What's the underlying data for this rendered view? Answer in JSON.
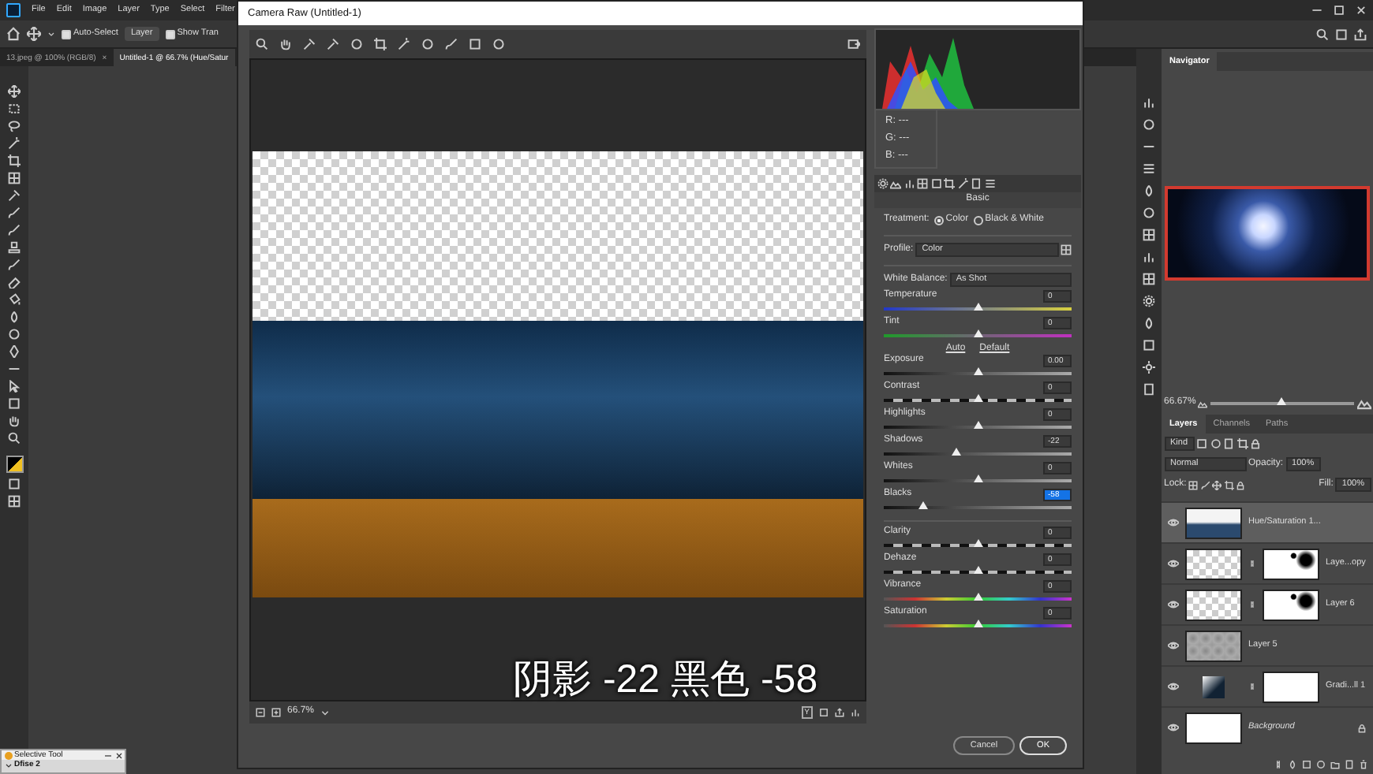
{
  "menu_bar": {
    "items": [
      "File",
      "Edit",
      "Image",
      "Layer",
      "Type",
      "Select",
      "Filter"
    ]
  },
  "options_bar": {
    "auto_select": {
      "label": "Auto-Select",
      "checked": true
    },
    "target": "Layer",
    "show_transform": {
      "label": "Show Tran",
      "checked": true
    }
  },
  "document_tabs": [
    {
      "label": "13.jpeg @ 100% (RGB/8)",
      "selected": false,
      "close": "×"
    },
    {
      "label": "Untitled-1 @ 66.7% (Hue/Satur",
      "selected": true
    }
  ],
  "navigator": {
    "title": "Navigator",
    "zoom": "66.67%",
    "level": 0.5
  },
  "layers_panel": {
    "tabs": [
      {
        "label": "Layers",
        "selected": true
      },
      {
        "label": "Channels",
        "selected": false
      },
      {
        "label": "Paths",
        "selected": false
      }
    ],
    "filter": "Kind",
    "blend_mode": "Normal",
    "opacity_label": "Opacity:",
    "opacity": "100%",
    "lock_label": "Lock:",
    "fill_label": "Fill:",
    "fill": "100%",
    "layers": [
      {
        "name": "Hue/Saturation 1...",
        "selected": true,
        "visible": true,
        "thumbnail": {
          "kind": "adjusted"
        },
        "locked": false
      },
      {
        "name": "Laye...opy",
        "selected": false,
        "visible": true,
        "thumbnail": {
          "kind": "photo"
        },
        "mask": {
          "kind": "spots"
        },
        "locked": false
      },
      {
        "name": "Layer 6",
        "selected": false,
        "visible": true,
        "thumbnail": {
          "kind": "photo"
        },
        "mask": {
          "kind": "spots"
        },
        "locked": false
      },
      {
        "name": "Layer 5",
        "selected": false,
        "visible": true,
        "thumbnail": {
          "kind": "checker"
        },
        "locked": false
      },
      {
        "name": "Gradi...ll 1",
        "selected": false,
        "visible": true,
        "thumbnail": {
          "kind": "gradient"
        },
        "mask": {
          "kind": "white"
        },
        "locked": false
      },
      {
        "name": "Background",
        "selected": false,
        "visible": true,
        "thumbnail": {
          "kind": "white"
        },
        "locked": true
      }
    ]
  },
  "selective_tool": {
    "title": "Selective Tool",
    "item": "Dfise 2"
  },
  "dialog": {
    "title": "Camera Raw (Untitled-1)",
    "zoom": "66.7%",
    "view_toggle": "Y",
    "caption": "阴影 -22 黑色 -58",
    "readout": [
      "R: ---",
      "G: ---",
      "B: ---"
    ],
    "panel_title": "Basic",
    "treatment": {
      "label": "Treatment:",
      "options": [
        {
          "label": "Color",
          "selected": true
        },
        {
          "label": "Black & White",
          "selected": false
        }
      ]
    },
    "profile": {
      "label": "Profile:",
      "value": "Color"
    },
    "white_balance": {
      "label": "White Balance:",
      "value": "As Shot"
    },
    "white_balance_sliders": [
      {
        "label": "Temperature",
        "value": "0",
        "level": 0.5,
        "kind": "temperature",
        "focused": false
      },
      {
        "label": "Tint",
        "value": "0",
        "level": 0.5,
        "kind": "tint",
        "focused": false
      }
    ],
    "tone_links": [
      "Auto",
      "Default"
    ],
    "tone_sliders": [
      {
        "label": "Exposure",
        "value": "0.00",
        "level": 0.5,
        "kind": "gradient",
        "focused": false
      },
      {
        "label": "Contrast",
        "value": "0",
        "level": 0.5,
        "kind": "dashed",
        "focused": false
      },
      {
        "label": "Highlights",
        "value": "0",
        "level": 0.5,
        "kind": "gradient",
        "focused": false
      },
      {
        "label": "Shadows",
        "value": "-22",
        "level": 0.39,
        "kind": "gradient",
        "focused": false
      },
      {
        "label": "Whites",
        "value": "0",
        "level": 0.5,
        "kind": "gradient",
        "focused": false
      },
      {
        "label": "Blacks",
        "value": "-58",
        "level": 0.21,
        "kind": "gradient",
        "focused": true
      }
    ],
    "presence_sliders": [
      {
        "label": "Clarity",
        "value": "0",
        "level": 0.5,
        "kind": "dashed",
        "focused": false
      },
      {
        "label": "Dehaze",
        "value": "0",
        "level": 0.5,
        "kind": "dashed",
        "focused": false
      },
      {
        "label": "Vibrance",
        "value": "0",
        "level": 0.5,
        "kind": "spectrum",
        "focused": false
      },
      {
        "label": "Saturation",
        "value": "0",
        "level": 0.5,
        "kind": "spectrum",
        "focused": false
      }
    ],
    "buttons": [
      {
        "label": "Cancel",
        "primary": false
      },
      {
        "label": "OK",
        "primary": true
      }
    ]
  }
}
